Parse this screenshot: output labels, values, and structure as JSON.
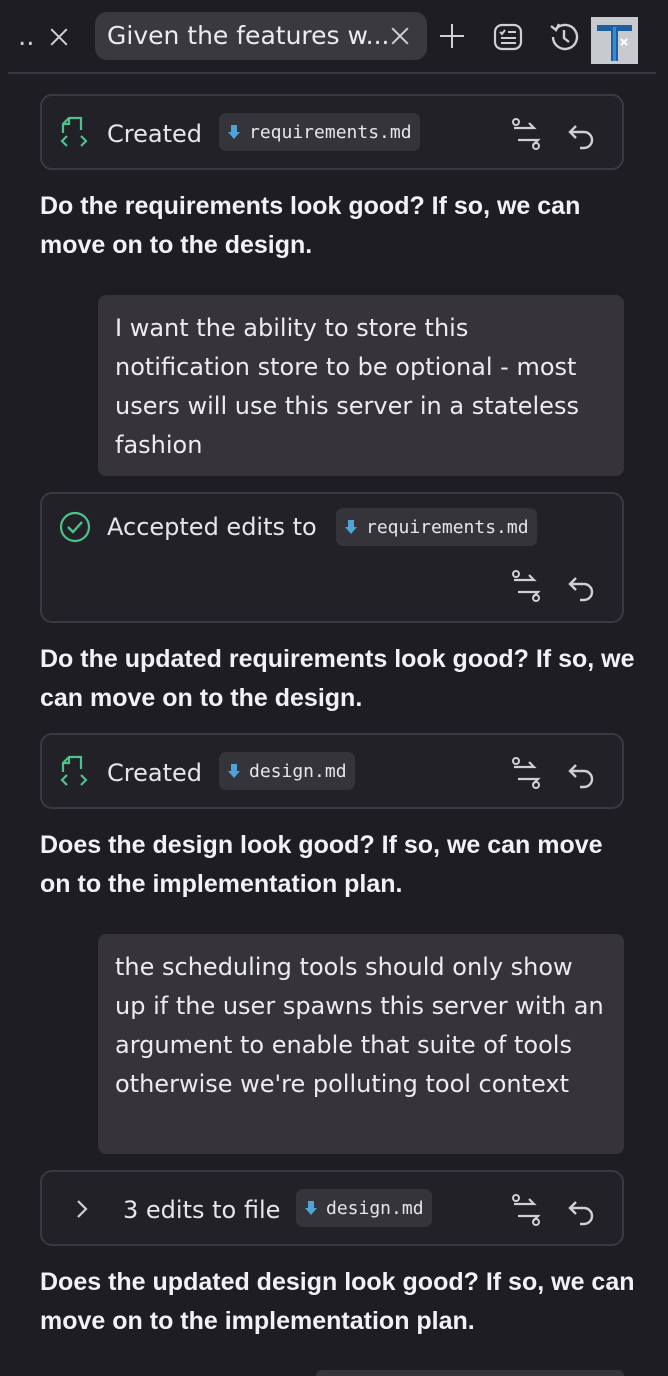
{
  "header": {
    "overflow_label": "..",
    "tab_title": "Given the features w..."
  },
  "messages": {
    "created_requirements": {
      "label": "Created",
      "file": "requirements.md"
    },
    "question_1": "Do the requirements look good? If so, we can move on to the design.",
    "user_1": "I want the ability to store this notification store to be optional - most users will use this server in a stateless fashion",
    "accepted_edits": {
      "label": "Accepted edits to",
      "file": "requirements.md"
    },
    "question_2": "Do the updated requirements look good? If so, we can move on to the design.",
    "created_design": {
      "label": "Created",
      "file": "design.md"
    },
    "question_3": "Does the design look good? If so, we can move on to the implementation plan.",
    "user_2": "the scheduling tools should only show up if the user spawns this server with an argument to enable that suite of tools otherwise we're polluting tool context",
    "edits_design": {
      "label": "3 edits to file",
      "file": "design.md"
    },
    "question_4": "Does the updated design look good? If so, we can move on to the implementation plan."
  },
  "colors": {
    "background": "#1e1d24",
    "accent_green": "#4cc38a",
    "file_icon_blue": "#4ea3d8"
  }
}
